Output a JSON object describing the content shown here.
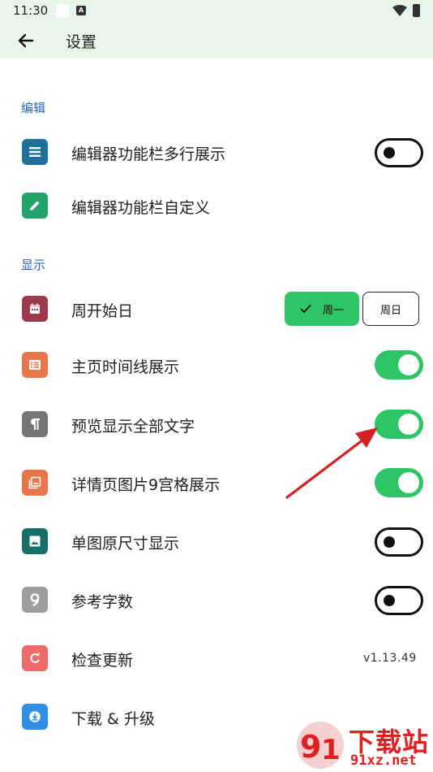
{
  "status_bar": {
    "time": "11:30",
    "badge": "A",
    "icons": [
      "square-icon",
      "a-badge-icon",
      "wifi-icon",
      "battery-icon"
    ]
  },
  "app_bar": {
    "title": "设置",
    "back_icon": "arrow-left-icon"
  },
  "sections": {
    "edit": {
      "header": "编辑"
    },
    "display": {
      "header": "显示"
    }
  },
  "rows": {
    "multiline_toolbar": {
      "label": "编辑器功能栏多行展示",
      "icon": "menu-lines-icon",
      "icon_color": "#1e6f9a",
      "toggle_on": false
    },
    "custom_toolbar": {
      "label": "编辑器功能栏自定义",
      "icon": "pencil-icon",
      "icon_color": "#21a36a"
    },
    "week_start": {
      "label": "周开始日",
      "icon": "calendar-icon",
      "icon_color": "#9b3a4e",
      "options": [
        "周一",
        "周日"
      ],
      "selected": "周一"
    },
    "timeline": {
      "label": "主页时间线展示",
      "icon": "list-icon",
      "icon_color": "#e8764a",
      "toggle_on": true
    },
    "preview_full": {
      "label": "预览显示全部文字",
      "icon": "pilcrow-icon",
      "icon_color": "#767676",
      "toggle_on": true
    },
    "grid9": {
      "label": "详情页图片9宫格展示",
      "icon": "photo-library-icon",
      "icon_color": "#e8764a",
      "toggle_on": true
    },
    "original_size": {
      "label": "单图原尺寸显示",
      "icon": "image-icon",
      "icon_color": "#1a6e6a",
      "toggle_on": false
    },
    "word_count": {
      "label": "参考字数",
      "icon": "nine-icon",
      "icon_color": "#9e9e9e",
      "toggle_on": false
    },
    "check_update": {
      "label": "检查更新",
      "icon": "refresh-icon",
      "icon_color": "#ef6a6a",
      "version": "v1.13.49"
    },
    "download": {
      "label": "下载 & 升级",
      "icon": "download-icon",
      "icon_color": "#2f8fe6"
    }
  },
  "watermark": {
    "text": "下载站",
    "url": "91xz.net",
    "colors": {
      "red": "#e02020"
    }
  },
  "colors": {
    "accent_green": "#2ec566",
    "section_blue": "#2b65b8",
    "appbar_bg": "#e8f5ec"
  }
}
